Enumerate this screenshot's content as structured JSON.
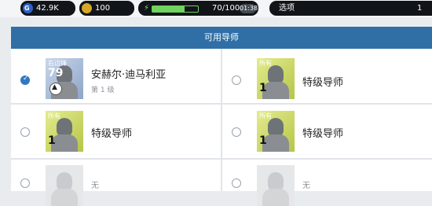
{
  "top_bar": {
    "gp": "42.9K",
    "coins": "100",
    "energy_value": "70/100",
    "energy_fill": 0.7,
    "timer": "01:38",
    "options_label": "选项",
    "options_value": "1"
  },
  "panel": {
    "title": "可用导师",
    "cards": [
      {
        "name": "安赫尔·迪马利亚",
        "sub": "第 1 级",
        "selected": true,
        "portrait_position": "右边锋",
        "portrait_rating": "79"
      },
      {
        "name": "特级导师",
        "selected": false,
        "portrait_tag": "所有",
        "portrait_level": "1"
      },
      {
        "name": "特级导师",
        "selected": false,
        "portrait_tag": "所有",
        "portrait_level": "1"
      },
      {
        "name": "特级导师",
        "selected": false,
        "portrait_tag": "所有",
        "portrait_level": "1"
      },
      {
        "name": "无",
        "selected": false
      },
      {
        "name": "无",
        "selected": false
      }
    ]
  }
}
